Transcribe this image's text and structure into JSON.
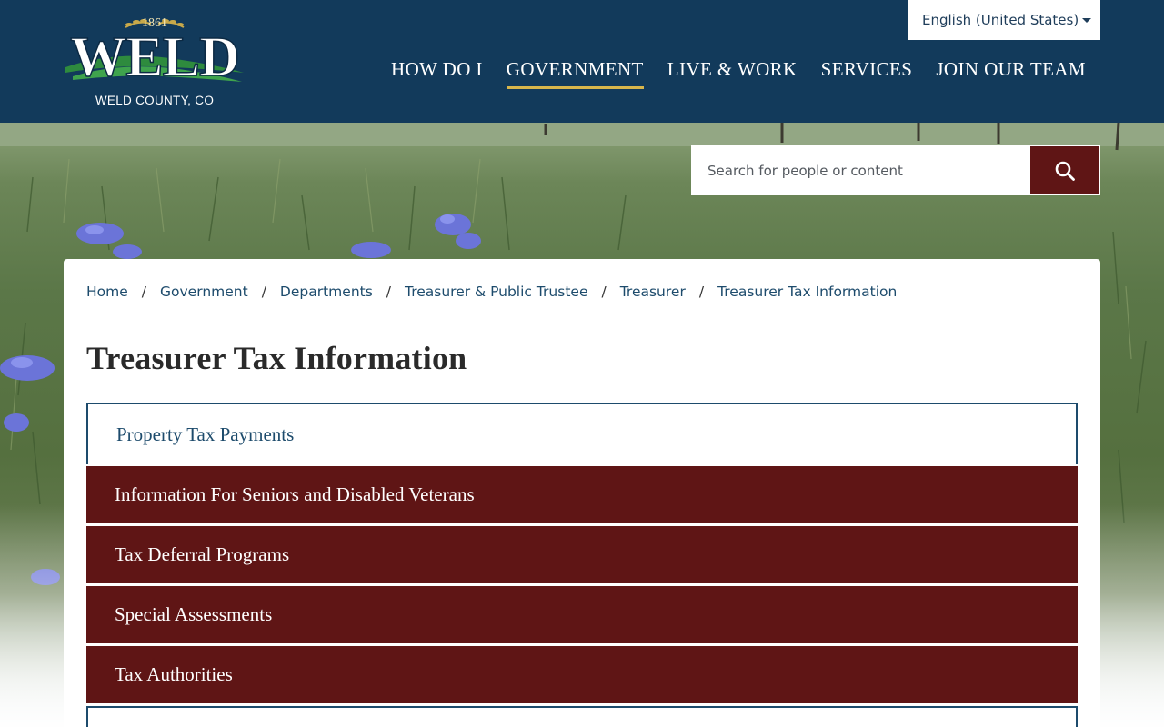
{
  "header": {
    "logo": {
      "year": "1861",
      "wordmark": "WELD",
      "subtitle": "WELD COUNTY, CO"
    },
    "nav": [
      {
        "label": "HOW DO I",
        "active": false
      },
      {
        "label": "GOVERNMENT",
        "active": true
      },
      {
        "label": "LIVE & WORK",
        "active": false
      },
      {
        "label": "SERVICES",
        "active": false
      },
      {
        "label": "JOIN OUR TEAM",
        "active": false
      }
    ],
    "language": {
      "selected": "English (United States)"
    }
  },
  "search": {
    "placeholder": "Search for people or content"
  },
  "breadcrumb": [
    "Home",
    "Government",
    "Departments",
    "Treasurer & Public Trustee",
    "Treasurer",
    "Treasurer Tax Information"
  ],
  "page": {
    "title": "Treasurer Tax Information"
  },
  "accordion": {
    "first": "Property Tax Payments",
    "items": [
      "Information For Seniors and Disabled Veterans",
      "Tax Deferral Programs",
      "Special Assessments",
      "Tax Authorities"
    ]
  },
  "colors": {
    "header_bg": "#123a5b",
    "accent_gold": "#d8b64c",
    "maroon": "#5f1515",
    "link_blue": "#1d4b6c"
  },
  "icons": {
    "search": "search-icon",
    "language_caret": "chevron-down-icon"
  }
}
